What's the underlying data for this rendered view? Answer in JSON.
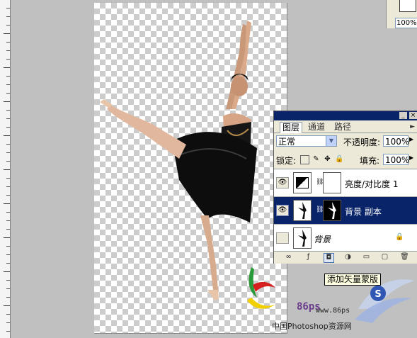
{
  "zoom_field": "100%",
  "layers_panel": {
    "tabs": [
      {
        "label": "图层",
        "active": true
      },
      {
        "label": "通道",
        "active": false
      },
      {
        "label": "路径",
        "active": false
      }
    ],
    "blend_mode": "正常",
    "opacity_label": "不透明度:",
    "opacity_value": "100%",
    "lock_label": "锁定:",
    "fill_label": "填充:",
    "fill_value": "100%",
    "layers": [
      {
        "name": "亮度/对比度 1",
        "visible": true,
        "selected": false
      },
      {
        "name": "背景 副本",
        "visible": true,
        "selected": true
      },
      {
        "name": "背景",
        "visible": false,
        "selected": false,
        "locked": true
      }
    ]
  },
  "tooltip": "添加矢量蒙版",
  "watermark": {
    "brand": "86ps",
    "url": "www.86ps",
    "caption": "中国Photoshop资源网"
  },
  "colors": {
    "selection": "#0a246a",
    "panel_bg": "#ece9d8",
    "workspace": "#c0c0c0"
  }
}
